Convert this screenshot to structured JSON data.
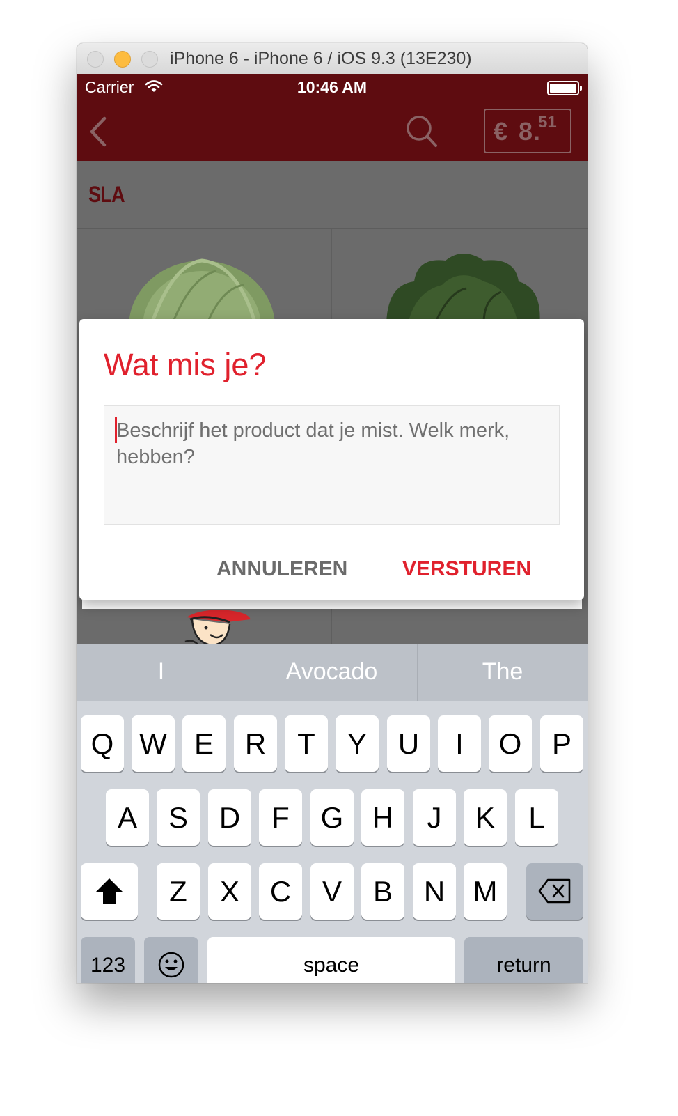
{
  "window": {
    "title": "iPhone 6 - iPhone 6 / iOS 9.3 (13E230)"
  },
  "status_bar": {
    "carrier": "Carrier",
    "time": "10:46 AM"
  },
  "nav": {
    "price_currency": "€",
    "price_whole": "8",
    "price_dot": ".",
    "price_cents": "51"
  },
  "category": {
    "title": "SLA"
  },
  "dialog": {
    "title": "Wat mis je?",
    "placeholder": "Beschrijf het product dat je mist. Welk merk,\nhebben?",
    "cancel_label": "ANNULEREN",
    "send_label": "VERSTUREN"
  },
  "keyboard": {
    "suggestions": [
      "I",
      "Avocado",
      "The"
    ],
    "row1": [
      "Q",
      "W",
      "E",
      "R",
      "T",
      "Y",
      "U",
      "I",
      "O",
      "P"
    ],
    "row2": [
      "A",
      "S",
      "D",
      "F",
      "G",
      "H",
      "J",
      "K",
      "L"
    ],
    "row3": [
      "Z",
      "X",
      "C",
      "V",
      "B",
      "N",
      "M"
    ],
    "numbers_label": "123",
    "space_label": "space",
    "return_label": "return"
  },
  "colors": {
    "brand_dark": "#5e0c10",
    "accent_red": "#e0212d"
  }
}
